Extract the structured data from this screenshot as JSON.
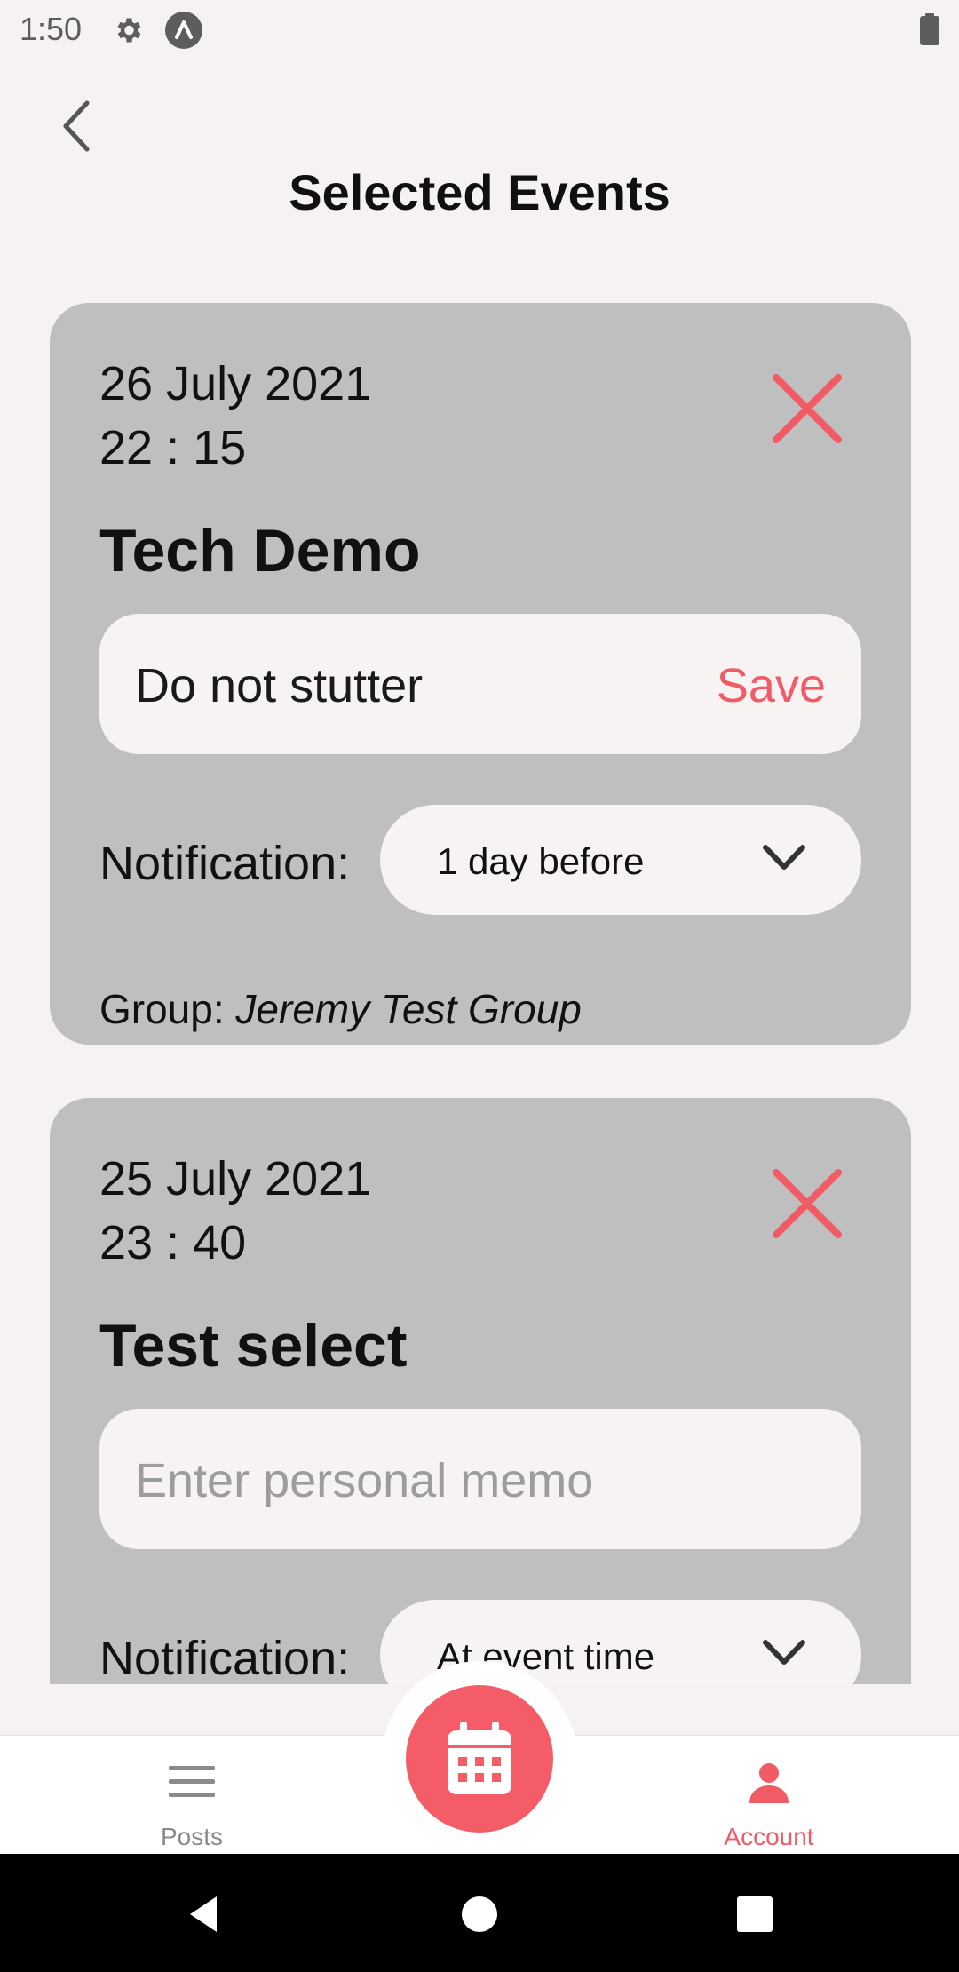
{
  "status_bar": {
    "time": "1:50"
  },
  "header": {
    "title": "Selected Events"
  },
  "events": [
    {
      "date": "26 July 2021",
      "time": "22 : 15",
      "name": "Tech Demo",
      "memo_value": "Do not stutter",
      "memo_placeholder": "",
      "save_label": "Save",
      "notification_label": "Notification:",
      "notification_value": "1 day before",
      "group_label": "Group: ",
      "group_name": "Jeremy Test Group"
    },
    {
      "date": "25 July 2021",
      "time": "23 : 40",
      "name": "Test select",
      "memo_value": "",
      "memo_placeholder": "Enter personal memo",
      "notification_label": "Notification:",
      "notification_value": "At event time"
    }
  ],
  "bottom_nav": {
    "items": [
      {
        "label": "Posts",
        "icon": "menu-icon",
        "active": false
      },
      {
        "label": "Account",
        "icon": "person-icon",
        "active": true
      }
    ],
    "center_button_icon": "calendar-icon"
  },
  "colors": {
    "accent": "#f15b66",
    "card_bg": "#bfbfbf",
    "page_bg": "#f6f2f1"
  }
}
